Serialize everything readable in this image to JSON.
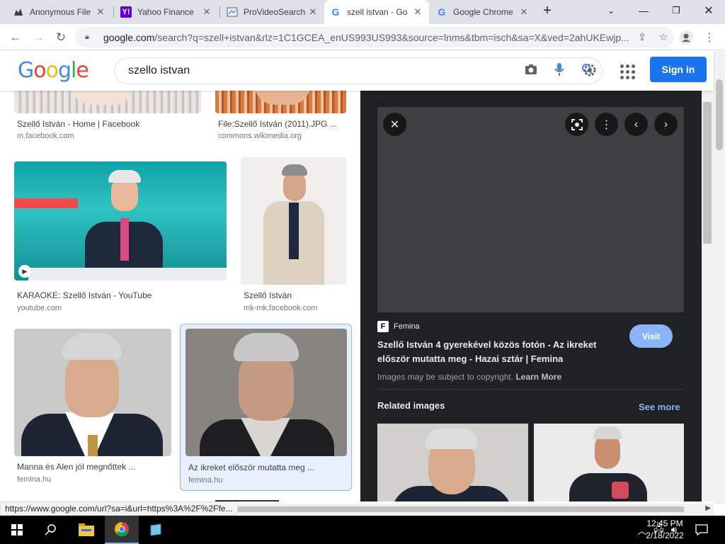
{
  "tabs": [
    {
      "title": "Anonymous File",
      "icon": "anonymous-icon",
      "active": false
    },
    {
      "title": "Yahoo Finance",
      "icon": "yahoo-icon",
      "active": false
    },
    {
      "title": "ProVideoSearch",
      "icon": "provideo-icon",
      "active": false
    },
    {
      "title": "szell istvan - Go",
      "icon": "google-g-icon",
      "active": true
    },
    {
      "title": "Google Chrome",
      "icon": "google-g-icon",
      "active": false
    }
  ],
  "address": {
    "domain": "google.com",
    "path": "/search?q=szell+istvan&rlz=1C1GCEA_enUS993US993&source=lnms&tbm=isch&sa=X&ved=2ahUKEwjp..."
  },
  "google": {
    "logo": "Google",
    "query": "szello istvan",
    "signin": "Sign in"
  },
  "results": [
    {
      "caption": "Szellő István - Home | Facebook",
      "source": "m.facebook.com"
    },
    {
      "caption": "File:Szellő István (2011).JPG ...",
      "source": "commons.wikimedia.org"
    },
    {
      "caption": "KARAOKE: Szellő István - YouTube",
      "source": "youtube.com"
    },
    {
      "caption": "Szellő István",
      "source": "mk-mk.facebook.com"
    },
    {
      "caption": "Manna és Alen jól megnőttek ...",
      "source": "femina.hu"
    },
    {
      "caption": "Az ikreket először mutatta meg ...",
      "source": "femina.hu"
    }
  ],
  "preview": {
    "source_letter": "F",
    "source_name": "Femina",
    "title": "Szellő István 4 gyerekével közös fotón - Az ikreket először mutatta meg - Hazai sztár | Femina",
    "visit": "Visit",
    "copyright": "Images may be subject to copyright.",
    "learn_more": "Learn More",
    "related": "Related images",
    "see_more": "See more"
  },
  "status_url": "https://www.google.com/url?sa=i&url=https%3A%2F%2Ffe...",
  "taskbar": {
    "time": "12:45 PM",
    "date": "2/18/2022"
  },
  "colors": {
    "accent": "#1a73e8",
    "preview_bg": "#202124",
    "visit_button": "#8ab4f8"
  }
}
